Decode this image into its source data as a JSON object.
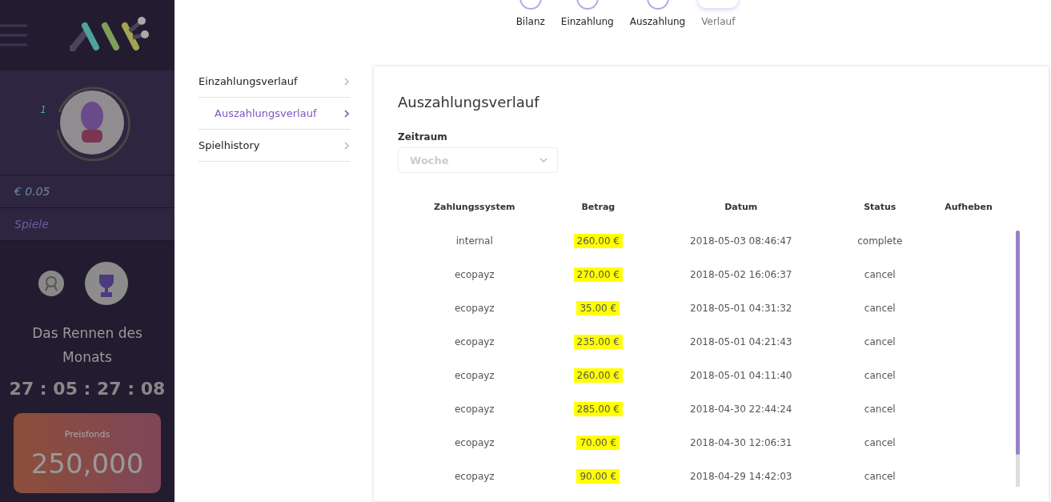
{
  "sidebar": {
    "level_number": "1",
    "balance": "€ 0.05",
    "games_label": "Spiele",
    "race_title": "Das Rennen des Monats",
    "countdown": "27 : 05 : 27 : 08",
    "prize_label": "Preisfonds",
    "prize_amount": "250,000"
  },
  "tabs": [
    {
      "label": "Bilanz",
      "selected": false
    },
    {
      "label": "Einzahlung",
      "selected": false
    },
    {
      "label": "Auszahlung",
      "selected": false
    },
    {
      "label": "Verlauf",
      "selected": true
    }
  ],
  "history_menu": [
    {
      "label": "Einzahlungsverlauf",
      "selected": false
    },
    {
      "label": "Auszahlungsverlauf",
      "selected": true
    },
    {
      "label": "Spielhistory",
      "selected": false
    }
  ],
  "card": {
    "title": "Auszahlungsverlauf",
    "period_label": "Zeitraum",
    "period_placeholder": "Woche"
  },
  "table": {
    "columns": [
      "Zahlungssystem",
      "Betrag",
      "Datum",
      "Status",
      "Aufheben"
    ],
    "rows": [
      {
        "system": "internal",
        "amount": "260.00 €",
        "highlighted": true,
        "date": "2018-05-03 08:46:47",
        "status": "complete"
      },
      {
        "system": "ecopayz",
        "amount": "270.00 €",
        "highlighted": true,
        "date": "2018-05-02 16:06:37",
        "status": "cancel"
      },
      {
        "system": "ecopayz",
        "amount": "35.00 €",
        "highlighted": true,
        "date": "2018-05-01 04:31:32",
        "status": "cancel"
      },
      {
        "system": "ecopayz",
        "amount": "235.00 €",
        "highlighted": true,
        "date": "2018-05-01 04:21:43",
        "status": "cancel"
      },
      {
        "system": "ecopayz",
        "amount": "260.00 €",
        "highlighted": true,
        "date": "2018-05-01 04:11:40",
        "status": "cancel"
      },
      {
        "system": "ecopayz",
        "amount": "285.00 €",
        "highlighted": true,
        "date": "2018-04-30 22:44:24",
        "status": "cancel"
      },
      {
        "system": "ecopayz",
        "amount": "70.00 €",
        "highlighted": true,
        "date": "2018-04-30 12:06:31",
        "status": "cancel"
      },
      {
        "system": "ecopayz",
        "amount": "90.00 €",
        "highlighted": true,
        "date": "2018-04-29 14:42:03",
        "status": "cancel"
      }
    ]
  }
}
